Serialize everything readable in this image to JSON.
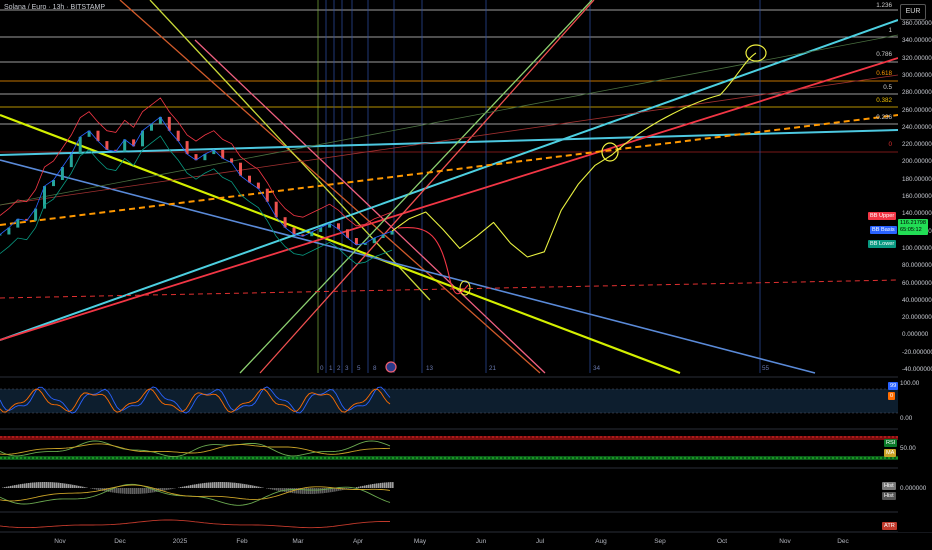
{
  "symbol": "Solana / Euro · 13h · BITSTAMP",
  "currency": "EUR",
  "price_axis": [
    "360.000000",
    "340.000000",
    "320.000000",
    "300.000000",
    "280.000000",
    "260.000000",
    "240.000000",
    "220.000000",
    "200.000000",
    "180.000000",
    "160.000000",
    "140.000000",
    "120.000000",
    "100.000000",
    "80.000000",
    "60.000000",
    "40.000000",
    "20.000000",
    "0.000000",
    "-20.000000",
    "-40.000000"
  ],
  "fib_levels": [
    {
      "label": "1.236",
      "color": "#d0d0d0"
    },
    {
      "label": "1",
      "color": "#d0d0d0"
    },
    {
      "label": "0.786",
      "color": "#d0d0d0"
    },
    {
      "label": "0.618",
      "color": "#ff9800"
    },
    {
      "label": "0.5",
      "color": "#d0d0d0"
    },
    {
      "label": "0.382",
      "color": "#f0c000"
    },
    {
      "label": "0.236",
      "color": "#d0d0d0"
    },
    {
      "label": "0",
      "color": "#e03030"
    }
  ],
  "time_axis": [
    "Nov",
    "Dec",
    "2025",
    "Feb",
    "Mar",
    "Apr",
    "May",
    "Jun",
    "Jul",
    "Aug",
    "Sep",
    "Oct",
    "Nov",
    "Dec"
  ],
  "vline_labels": [
    "0",
    "1",
    "2",
    "3",
    "5",
    "8",
    "13",
    "21",
    "34",
    "55"
  ],
  "indicator_tags": [
    {
      "label": "BB Upper",
      "color": "#f23645"
    },
    {
      "label": "BB Basis",
      "color": "#2962ff"
    },
    {
      "label": "BB Lower",
      "color": "#089981"
    }
  ],
  "current_price": "116.21798",
  "price_countdown": "65:05:12",
  "pane_axes": {
    "stoch": [
      "100.00",
      "0.00"
    ],
    "rsi": [
      "50.00"
    ],
    "macd": [
      "0.000000"
    ],
    "stoch_tags": [
      "99",
      "0"
    ],
    "rsi_tags": [
      "RSI",
      "MA"
    ],
    "macd_tags": [
      "Hist",
      "Hist"
    ],
    "atr_tag": "ATR"
  },
  "colors": {
    "background": "#000000",
    "fib_red": "#e03030",
    "cyan": "#4dd0e1",
    "yellow": "#d4f000",
    "orange_dash": "#ff9800"
  },
  "chart_data": {
    "type": "line",
    "title": "Solana / Euro · 13h · BITSTAMP",
    "ylabel": "EUR",
    "ylim": [
      -40,
      360
    ],
    "x_categories": [
      "Nov",
      "Dec",
      "2025",
      "Feb",
      "Mar",
      "Apr",
      "May",
      "Jun",
      "Jul",
      "Aug",
      "Sep",
      "Oct",
      "Nov",
      "Dec"
    ],
    "series": [
      {
        "values": [
          112,
          120,
          130,
          128,
          142,
          168,
          175,
          190,
          205,
          225,
          232,
          220,
          210,
          208,
          222,
          214,
          232,
          240,
          248,
          232,
          220,
          205,
          198,
          205,
          210,
          200,
          195,
          180,
          172,
          165,
          150,
          132,
          120,
          112,
          110,
          115,
          120,
          125,
          118,
          108,
          100,
          102,
          108,
          112,
          116
        ]
      }
    ],
    "projection": {
      "values": [
        116,
        130,
        138,
        118,
        96,
        110,
        126,
        102,
        86,
        92,
        140,
        170,
        192,
        204
      ]
    },
    "grid": false
  }
}
